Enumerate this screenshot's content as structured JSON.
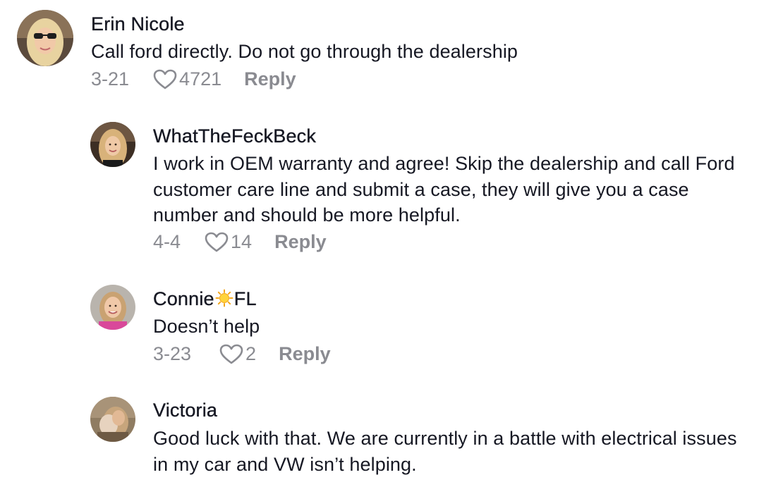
{
  "comments": [
    {
      "username": "Erin Nicole",
      "text": "Call ford directly. Do not go through the dealership",
      "date": "3-21",
      "likes": "4721",
      "reply_label": "Reply"
    },
    {
      "username": "WhatTheFeckBeck",
      "text": "I work in OEM warranty and agree! Skip the dealership and call Ford customer care line and submit a case, they will give you a case number and should be more helpful.",
      "date": "4-4",
      "likes": "14",
      "reply_label": "Reply"
    },
    {
      "username_parts": [
        "Connie",
        "FL"
      ],
      "username_emoji": "sun-emoji",
      "text": "Doesn’t help",
      "date": "3-23",
      "likes": "2",
      "reply_label": "Reply"
    },
    {
      "username": "Victoria",
      "text": "Good luck with that. We are currently in a battle with electrical issues in my car and VW isn’t helping."
    }
  ],
  "icons": {
    "like": "heart-outline-icon"
  },
  "colors": {
    "username": "#161823",
    "body_text": "#161823",
    "meta": "#8a8b91",
    "background": "#ffffff"
  }
}
